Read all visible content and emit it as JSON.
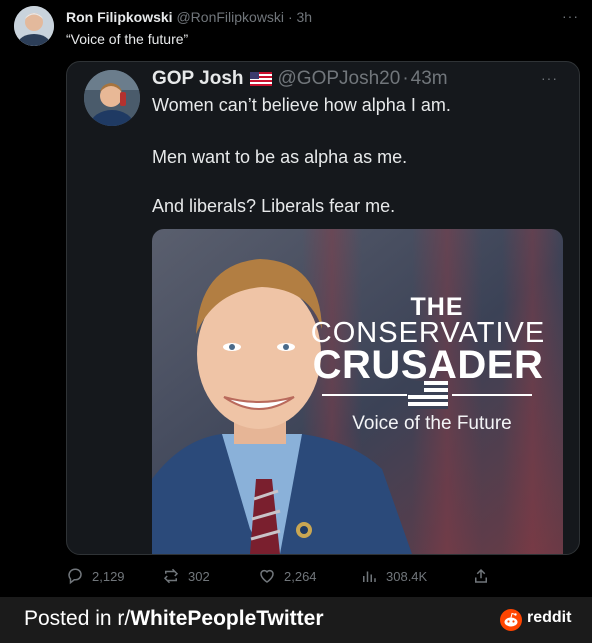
{
  "outer_tweet": {
    "name": "Ron Filipkowski",
    "handle": "@RonFilipkowski",
    "separator": "·",
    "time": "3h",
    "text": "“Voice of the future”",
    "more": "···"
  },
  "quoted_tweet": {
    "name": "GOP Josh",
    "handle": "@GOPJosh20",
    "separator": "·",
    "time": "43m",
    "more": "···",
    "lines": [
      "Women can’t believe how alpha I am.",
      "Men want to be as alpha as me.",
      "And liberals? Liberals fear me."
    ],
    "image": {
      "line1": "THE",
      "line2": "CONSERVATIVE",
      "line3": "CRUSADER",
      "line4": "Voice of the Future"
    }
  },
  "metrics": {
    "replies": "2,129",
    "reposts": "302",
    "likes": "2,264",
    "views": "308.4K"
  },
  "footer": {
    "prefix": "Posted in r/",
    "subreddit": "WhitePeopleTwitter",
    "brand": "reddit"
  },
  "icons": [
    "reply-icon",
    "repost-icon",
    "like-icon",
    "views-icon",
    "share-icon",
    "us-flag-icon",
    "reddit-icon"
  ],
  "colors": {
    "background": "#000000",
    "card": "#15181c",
    "muted": "#71767b",
    "reddit": "#ff4500"
  }
}
